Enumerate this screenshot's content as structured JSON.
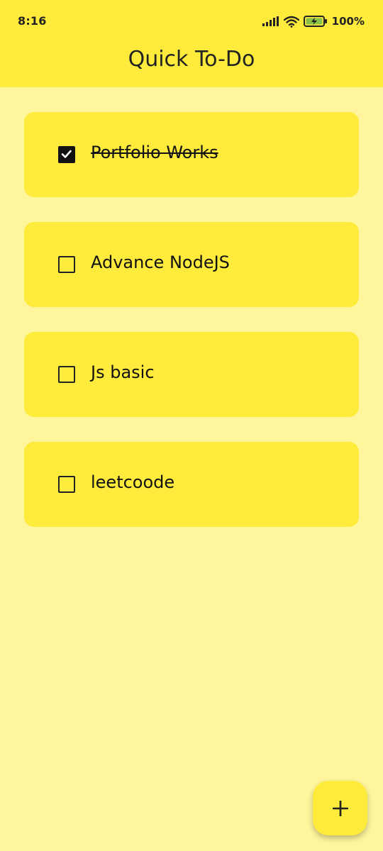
{
  "status_bar": {
    "time": "8:16",
    "battery_percent": "100%",
    "icons": [
      "signal-icon",
      "wifi-icon",
      "battery-charging-icon"
    ]
  },
  "app_bar": {
    "title": "Quick To-Do"
  },
  "todos": [
    {
      "label": "Portfolio Works",
      "checked": true
    },
    {
      "label": "Advance NodeJS",
      "checked": false
    },
    {
      "label": "Js basic",
      "checked": false
    },
    {
      "label": "leetcoode",
      "checked": false
    }
  ],
  "fab": {
    "icon": "plus-icon"
  },
  "colors": {
    "background": "#fff59d",
    "primary": "#ffeb3b",
    "text": "#111111",
    "battery_fill": "#8bc34a"
  }
}
